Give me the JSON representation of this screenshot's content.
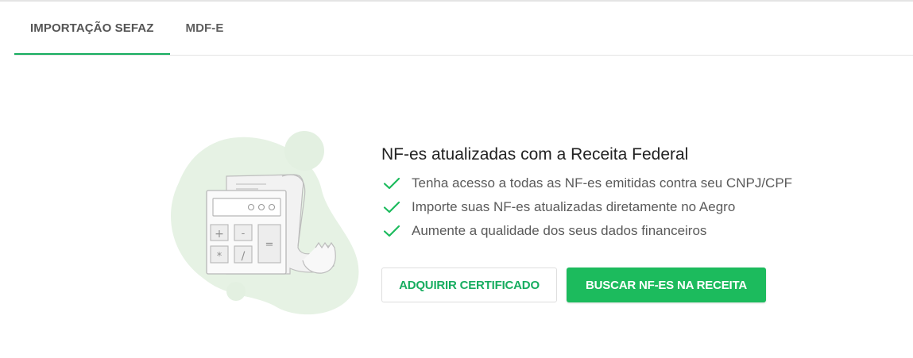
{
  "tabs": [
    {
      "label": "IMPORTAÇÃO SEFAZ",
      "active": true
    },
    {
      "label": "MDF-E",
      "active": false
    }
  ],
  "empty_state": {
    "illustration": "calculator-receipt-illustration",
    "title": "NF-es atualizadas com a Receita Federal",
    "features": [
      {
        "icon": "check-icon",
        "text": "Tenha acesso a todas as NF-es emitidas contra seu CNPJ/CPF"
      },
      {
        "icon": "check-icon",
        "text": "Importe suas NF-es atualizadas diretamente no Aegro"
      },
      {
        "icon": "check-icon",
        "text": "Aumente a qualidade dos seus dados financeiros"
      }
    ],
    "buttons": {
      "secondary_label": "ADQUIRIR CERTIFICADO",
      "primary_label": "BUSCAR NF-ES NA RECEITA"
    }
  },
  "colors": {
    "accent": "#1cbb5d",
    "accent_text": "#17ad60",
    "illustration_blob": "#e6f2e4"
  }
}
